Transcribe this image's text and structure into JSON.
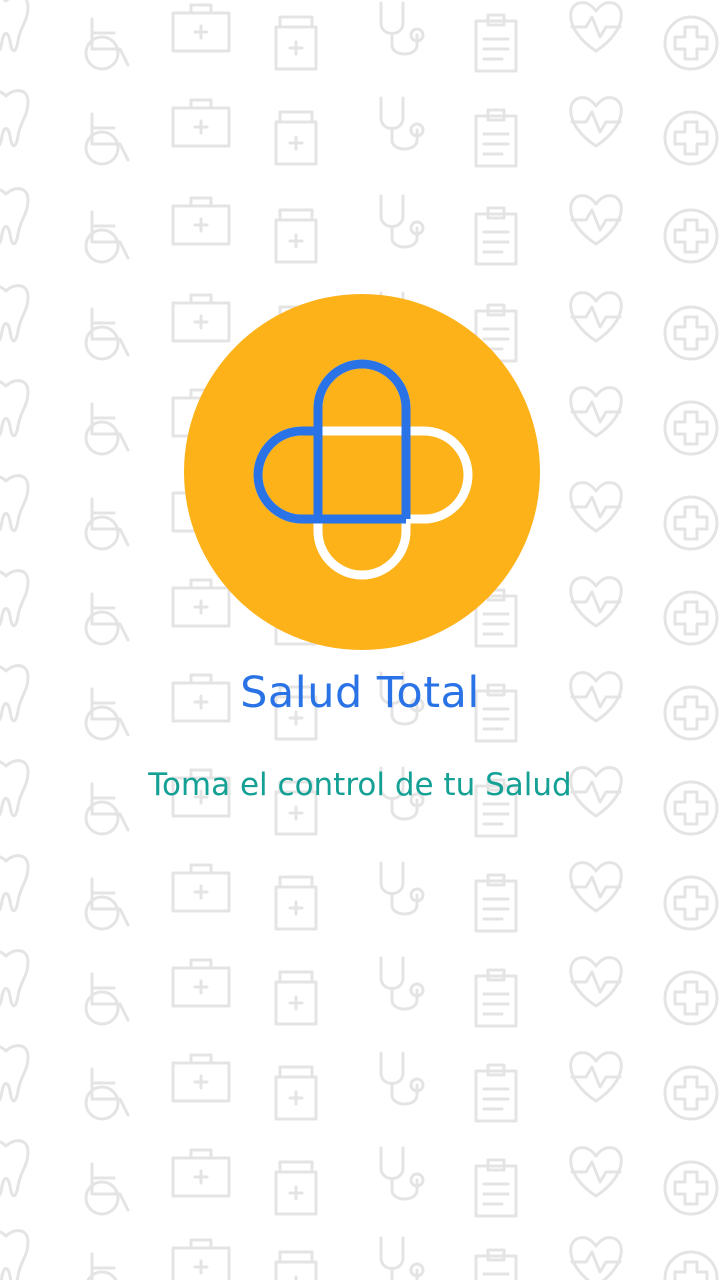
{
  "app": {
    "title": "Salud Total",
    "tagline": "Toma el control de tu Salud"
  },
  "colors": {
    "background": "#ffffff",
    "pattern": "#e4e4e4",
    "logo_circle": "#fdb21a",
    "logo_blue": "#2a73e6",
    "logo_white": "#ffffff",
    "title": "#2a73e6",
    "tagline": "#14a094"
  },
  "background_icons": [
    "tooth-icon",
    "medical-kit-icon",
    "stethoscope-icon",
    "heart-pulse-icon",
    "bandage-icon",
    "microscope-icon",
    "wheelchair-icon",
    "medicine-bottle-icon",
    "clipboard-icon",
    "medical-cross-icon",
    "iv-bag-icon"
  ],
  "logo": {
    "icon": "pill-cross-icon"
  }
}
